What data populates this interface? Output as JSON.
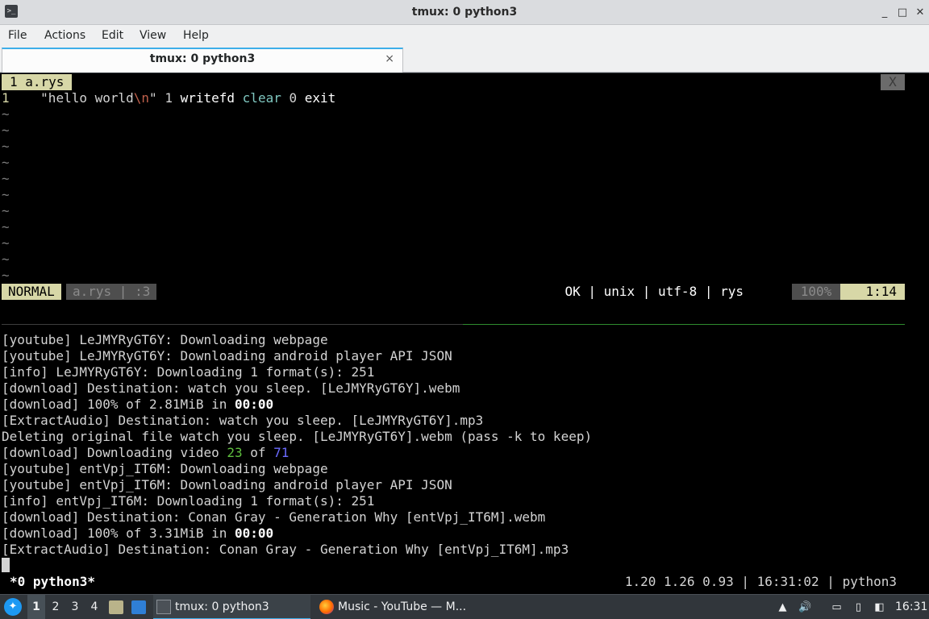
{
  "window": {
    "title": "tmux: 0 python3",
    "app_icon": "terminal-icon",
    "controls": {
      "minimize": "_",
      "maximize": "□",
      "close": "✕"
    }
  },
  "menu": [
    "File",
    "Actions",
    "Edit",
    "View",
    "Help"
  ],
  "tab": {
    "label": "tmux: 0 python3",
    "close": "×"
  },
  "editor": {
    "buffer_tab": "1 a.rys",
    "close_label": "X",
    "line_number": "1",
    "code": {
      "string_open": "\"hello world",
      "escape": "\\n",
      "string_close": "\"",
      "num1": "1",
      "kw1": "writefd",
      "kw2": "clear",
      "num2": "0",
      "kw3": "exit"
    },
    "tilde": "~",
    "status": {
      "mode": "NORMAL",
      "file": "a.rys | :3",
      "info": "OK | unix | utf-8 | rys",
      "percent": "100%",
      "position": "1:14"
    }
  },
  "output": {
    "lines": [
      "[youtube] LeJMYRyGT6Y: Downloading webpage",
      "[youtube] LeJMYRyGT6Y: Downloading android player API JSON",
      "[info] LeJMYRyGT6Y: Downloading 1 format(s): 251",
      "[download] Destination: watch you sleep. [LeJMYRyGT6Y].webm"
    ],
    "dl1_prefix": "[download] 100% of 2.81MiB in ",
    "dl1_time": "00:00",
    "line6": "[ExtractAudio] Destination: watch you sleep. [LeJMYRyGT6Y].mp3",
    "line7": "Deleting original file watch you sleep. [LeJMYRyGT6Y].webm (pass -k to keep)",
    "video_prefix": "[download] Downloading video ",
    "video_current": "23",
    "video_of": " of ",
    "video_total": "71",
    "lines2": [
      "[youtube] entVpj_IT6M: Downloading webpage",
      "[youtube] entVpj_IT6M: Downloading android player API JSON",
      "[info] entVpj_IT6M: Downloading 1 format(s): 251",
      "[download] Destination: Conan Gray - Generation Why [entVpj_IT6M].webm"
    ],
    "dl2_prefix": "[download] 100% of 3.31MiB in ",
    "dl2_time": "00:00",
    "line_last": "[ExtractAudio] Destination: Conan Gray - Generation Why [entVpj_IT6M].mp3"
  },
  "tmux": {
    "window_label": "*0 python3*",
    "status_right": "1.20 1.26 0.93 | 16:31:02 | python3"
  },
  "taskbar": {
    "workspaces": [
      "1",
      "2",
      "3",
      "4"
    ],
    "tasks": [
      {
        "label": "tmux: 0 python3",
        "icon": "terminal-icon"
      },
      {
        "label": "Music - YouTube — M...",
        "icon": "firefox-icon"
      }
    ],
    "clock": "16:31",
    "colors": {
      "accent": "#3daee9",
      "panel": "#31363b"
    }
  }
}
